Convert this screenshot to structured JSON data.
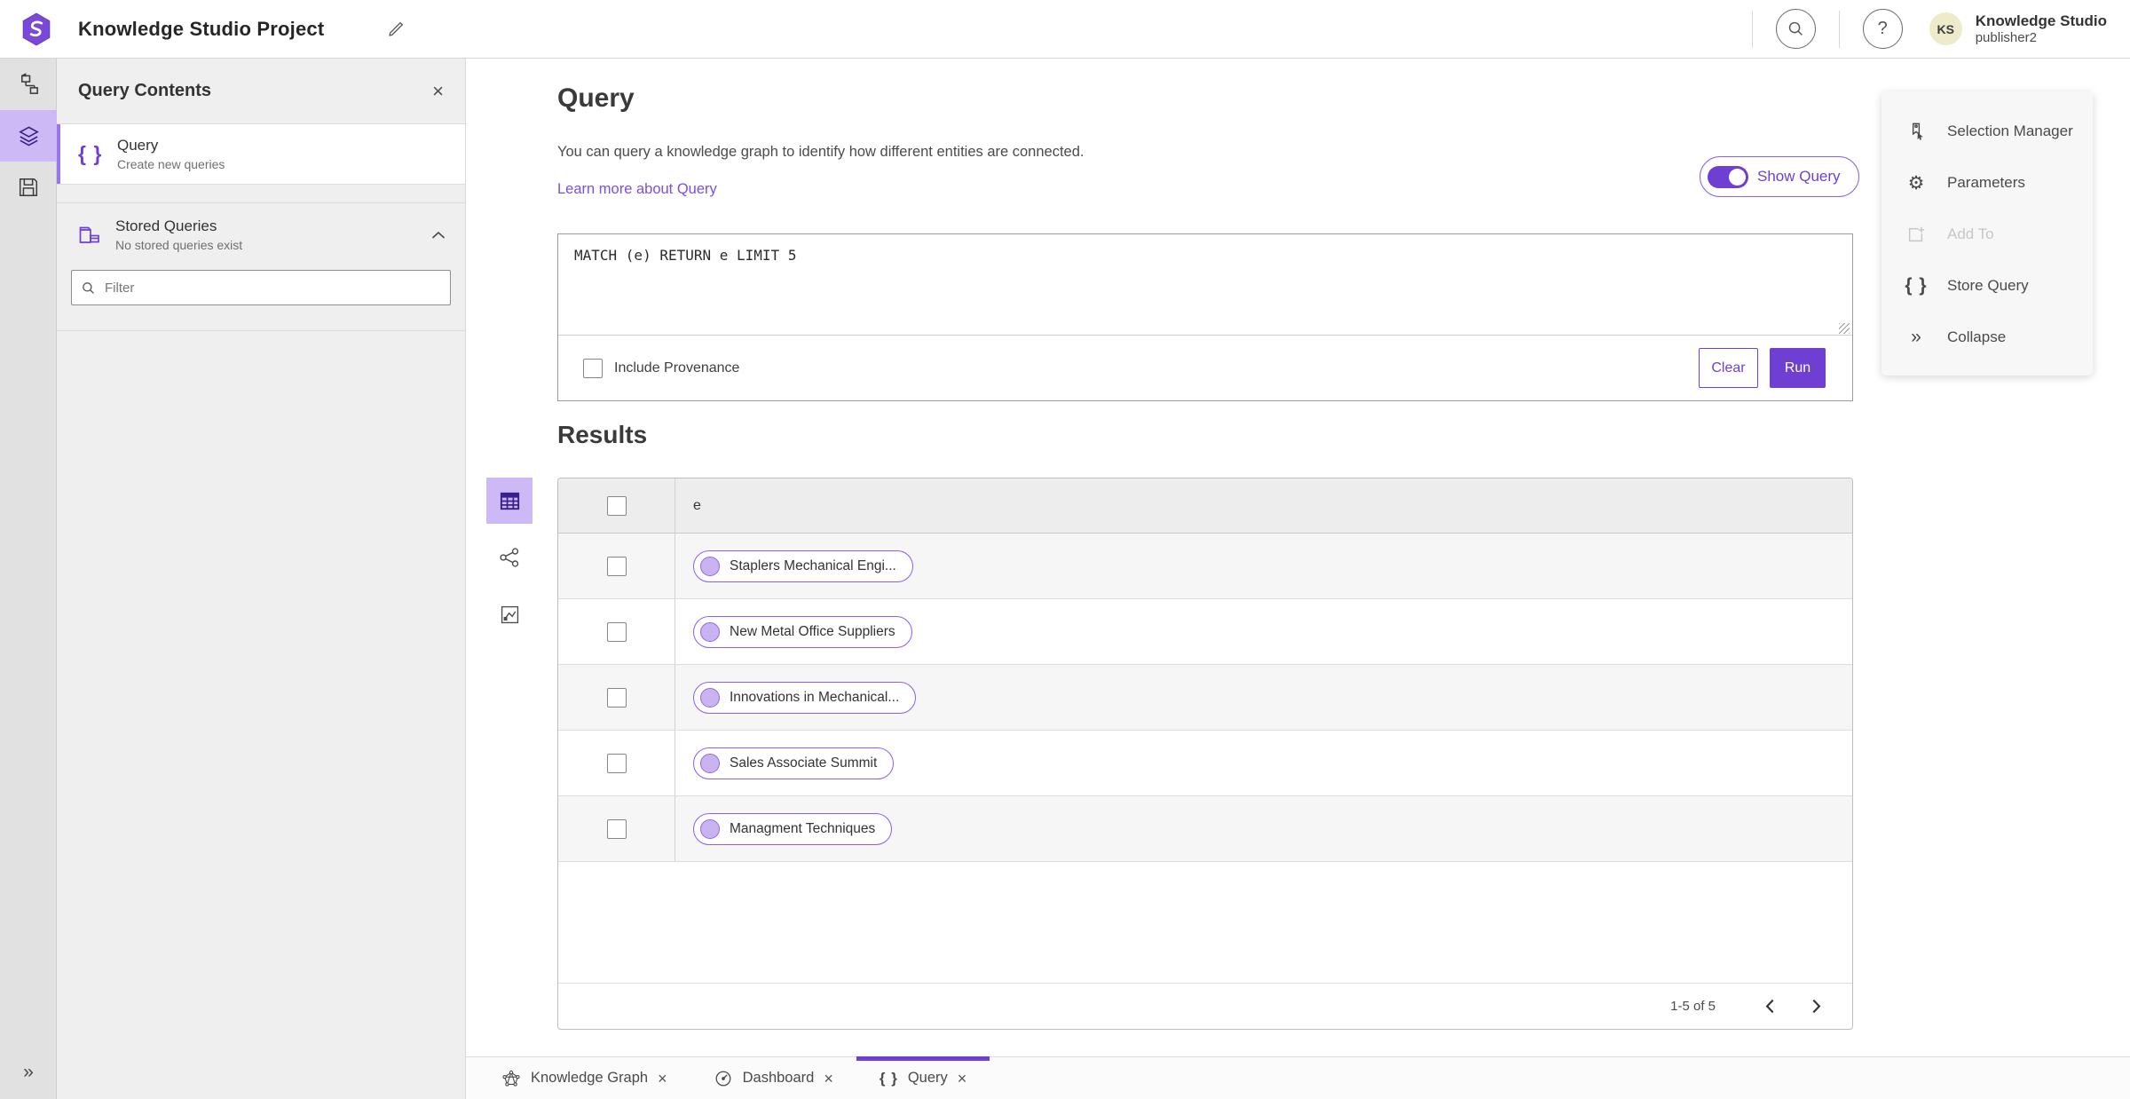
{
  "header": {
    "title": "Knowledge Studio Project",
    "user_name": "Knowledge Studio",
    "user_role": "publisher2",
    "avatar_initials": "KS"
  },
  "contents_panel": {
    "title": "Query Contents",
    "items": [
      {
        "label": "Query",
        "sublabel": "Create new queries"
      },
      {
        "label": "Stored Queries",
        "sublabel": "No stored queries exist"
      }
    ],
    "filter_placeholder": "Filter"
  },
  "main": {
    "title": "Query",
    "description": "You can query a knowledge graph to identify how different entities are connected.",
    "learn_more": "Learn more about Query",
    "show_query_label": "Show Query",
    "query_text": "MATCH (e) RETURN e LIMIT 5",
    "include_provenance_label": "Include Provenance",
    "clear_label": "Clear",
    "run_label": "Run",
    "results_title": "Results",
    "column_header": "e",
    "rows": [
      "Staplers Mechanical Engi...",
      "New Metal Office Suppliers",
      "Innovations in Mechanical...",
      "Sales Associate Summit",
      "Managment Techniques"
    ],
    "pagination": "1-5 of 5"
  },
  "tools_panel": {
    "items": [
      {
        "label": "Selection Manager",
        "disabled": false
      },
      {
        "label": "Parameters",
        "disabled": false
      },
      {
        "label": "Add To",
        "disabled": true
      },
      {
        "label": "Store Query",
        "disabled": false
      },
      {
        "label": "Collapse",
        "disabled": false
      }
    ]
  },
  "tabs": [
    {
      "label": "Knowledge Graph"
    },
    {
      "label": "Dashboard"
    },
    {
      "label": "Query"
    }
  ],
  "icons": {
    "help": "?",
    "close": "×",
    "braces": "{ }",
    "gear": "⚙",
    "collapse": "»",
    "expand_rail": "»"
  },
  "colors": {
    "accent": "#6f3fd4",
    "accent_light_bg": "#cdb9f6",
    "chip_border": "#8b5cf6",
    "chip_dot": "#c9b4f1",
    "link": "#7a4fe0",
    "avatar_bg": "#eeeaca",
    "panel_bg": "#efeff0",
    "rail_bg": "#e1e1e2",
    "table_header_bg": "#ededed",
    "row_stripe": "#f6f6f6"
  }
}
